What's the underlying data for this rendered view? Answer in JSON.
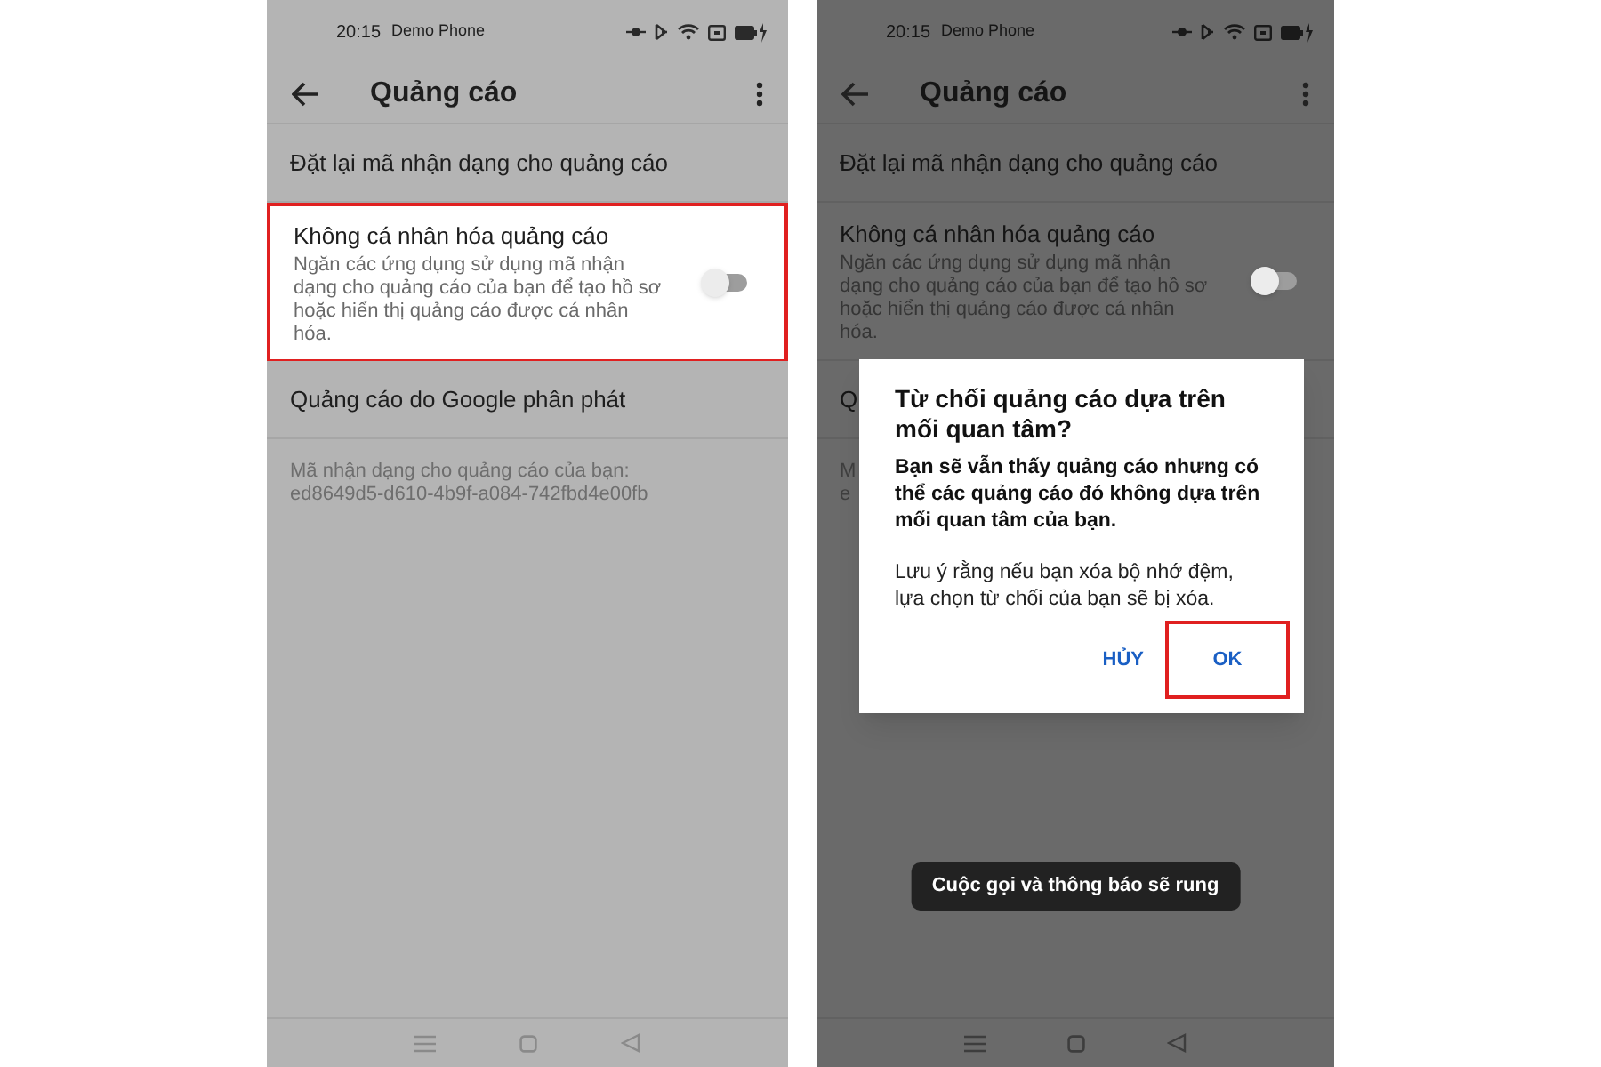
{
  "phones": [
    {
      "status": {
        "time": "20:15",
        "carrier": "Demo Phone"
      },
      "title": "Quảng cáo",
      "rows": [
        {
          "kind": "action",
          "label": "Đặt lại mã nhận dạng cho quảng cáo",
          "highlighted": false
        },
        {
          "kind": "toggle",
          "label": "Không cá nhân hóa quảng cáo",
          "description": "Ngăn các ứng dụng sử dụng mã nhận dạng cho quảng cáo của bạn để tạo hồ sơ hoặc hiển thị quảng cáo được cá nhân hóa.",
          "on": false,
          "highlighted": true
        },
        {
          "kind": "action",
          "label": "Quảng cáo do Google phân phát",
          "highlighted": false
        },
        {
          "kind": "info",
          "lines": [
            "Mã nhận dạng cho quảng cáo của bạn:",
            "ed8649d5-d610-4b9f-a084-742fbd4e00fb"
          ],
          "highlighted": false
        }
      ]
    },
    {
      "status": {
        "time": "20:15",
        "carrier": "Demo Phone"
      },
      "title": "Quảng cáo",
      "rows": [
        {
          "kind": "action",
          "label": "Đặt lại mã nhận dạng cho quảng cáo",
          "highlighted": false
        },
        {
          "kind": "toggle",
          "label": "Không cá nhân hóa quảng cáo",
          "description": "Ngăn các ứng dụng sử dụng mã nhận dạng cho quảng cáo của bạn để tạo hồ sơ hoặc hiển thị quảng cáo được cá nhân hóa.",
          "on": false,
          "highlighted": false
        },
        {
          "kind": "action",
          "label": "Q",
          "highlighted": false
        },
        {
          "kind": "info",
          "lines": [
            "M",
            "e"
          ],
          "highlighted": false
        }
      ],
      "dialog": {
        "title": "Từ chối quảng cáo dựa trên mối quan tâm?",
        "message": "Bạn sẽ vẫn thấy quảng cáo nhưng có thể các quảng cáo đó không dựa trên mối quan tâm của bạn.",
        "note": "Lưu ý rằng nếu bạn xóa bộ nhớ đệm, lựa chọn từ chối của bạn sẽ bị xóa.",
        "buttons": [
          {
            "label": "HỦY",
            "highlighted": false
          },
          {
            "label": "OK",
            "highlighted": true
          }
        ]
      },
      "toast": "Cuộc gọi và thông báo sẽ rung"
    }
  ]
}
